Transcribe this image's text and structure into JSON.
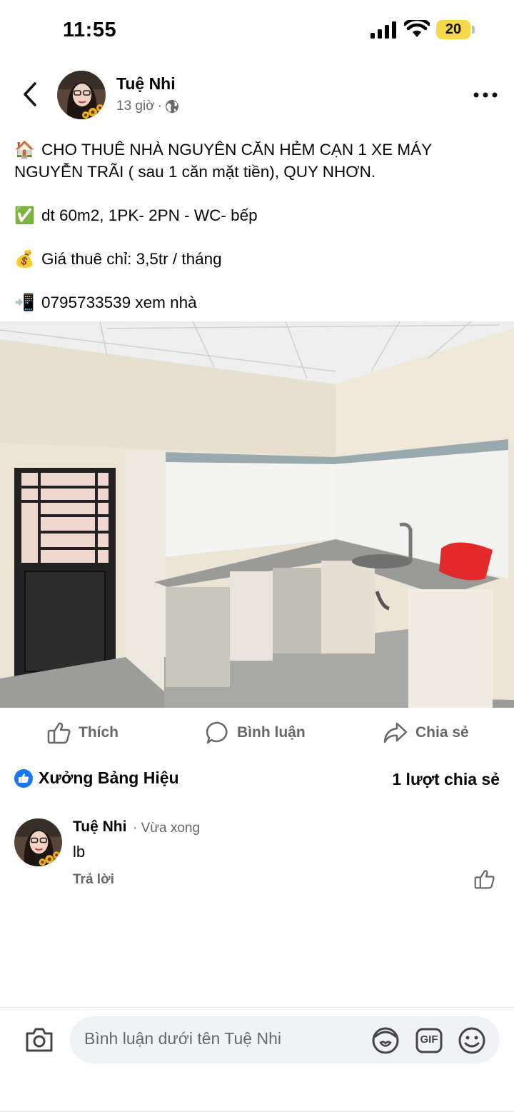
{
  "status_bar": {
    "time": "11:55",
    "battery": "20",
    "icons": [
      "cellular-signal-icon",
      "wifi-icon",
      "battery-icon"
    ]
  },
  "post": {
    "author": "Tuệ Nhi",
    "time": "13 giờ",
    "audience_icon": "globe-icon",
    "lines": [
      {
        "emoji": "🏠",
        "text": " CHO THUÊ NHÀ NGUYÊN CĂN HẺM CẠN 1 XE MÁY"
      },
      {
        "emoji": "",
        "text": "NGUYỄN TRÃI ( sau 1 căn mặt tiền), QUY NHƠN."
      },
      {
        "emoji": "✅",
        "text": "dt 60m2, 1PK- 2PN - WC- bếp"
      },
      {
        "emoji": "💰",
        "text": "Giá thuê chỉ: 3,5tr / tháng"
      },
      {
        "emoji": "📲",
        "text": "0795733539 xem nhà"
      }
    ]
  },
  "actions": {
    "like": "Thích",
    "comment": "Bình luận",
    "share": "Chia sẻ"
  },
  "reactions": {
    "reactor": "Xưởng Bảng Hiệu",
    "shares": "1 lượt chia sẻ"
  },
  "comment": {
    "author": "Tuệ Nhi",
    "time": "· Vừa xong",
    "text": "lb",
    "reply": "Trả lời"
  },
  "composer": {
    "placeholder": "Bình luận dưới tên Tuệ Nhi",
    "gif_label": "GIF"
  },
  "colors": {
    "accent": "#1877f2",
    "muted": "#65676b",
    "battery": "#f5d94a"
  }
}
